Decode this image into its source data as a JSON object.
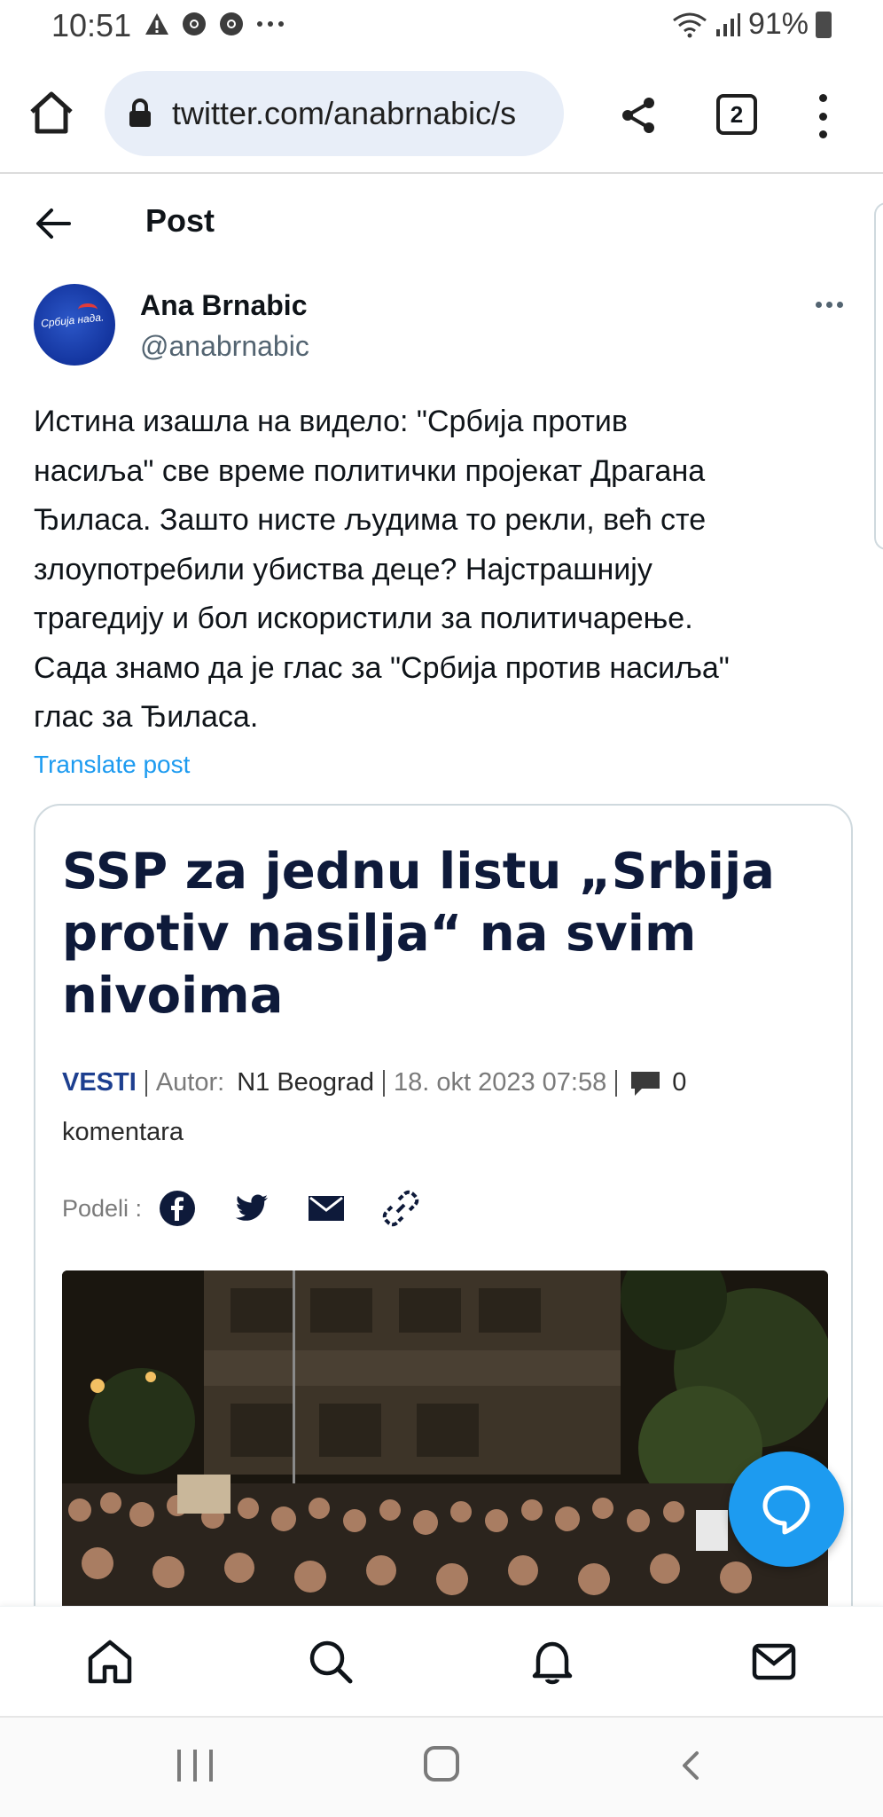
{
  "status_bar": {
    "time": "10:51",
    "left_icons": [
      "warning-icon",
      "chrome-icon",
      "chrome-icon",
      "more-dots-icon"
    ],
    "battery": "91%"
  },
  "browser": {
    "url": "twitter.com/anabrnabic/s",
    "tab_count": "2"
  },
  "post_header": {
    "title": "Post"
  },
  "author": {
    "name": "Ana Brnabic",
    "handle": "@anabrnabic",
    "avatar_text": "Србија нада."
  },
  "tweet": {
    "lines": [
      "Истина изашла на видело: \"Србија против",
      "насиља\" све време политички пројекат Драгана",
      "Ђиласа. Зашто нисте људима то рекли, већ сте",
      "злоупотребили убиства деце? Најстрашнију",
      "трагедију и бол искористили за политичарење.",
      "Сада знамо да је глас за \"Србија против насиља\"",
      "глас за Ђиласа."
    ],
    "translate_label": "Translate post"
  },
  "card": {
    "headline_lines": [
      "SSP za jednu listu „Srbija",
      "protiv nasilja“ na svim",
      "nivoima"
    ],
    "section": "VESTI",
    "author_label": "Autor:",
    "author": "N1 Beograd",
    "date": "18. okt 2023 07:58",
    "comment_count": "0",
    "comment_word": "komentara",
    "share_label": "Podeli :",
    "share_icons": [
      "facebook-icon",
      "twitter-icon",
      "email-icon",
      "link-icon"
    ]
  },
  "bottom_nav": [
    "home-icon",
    "search-icon",
    "notifications-icon",
    "messages-icon"
  ],
  "colors": {
    "accent": "#1d9bf0",
    "headline": "#0e1a3a",
    "vesti": "#1d3f8f",
    "url_bg": "#e8eef8"
  }
}
